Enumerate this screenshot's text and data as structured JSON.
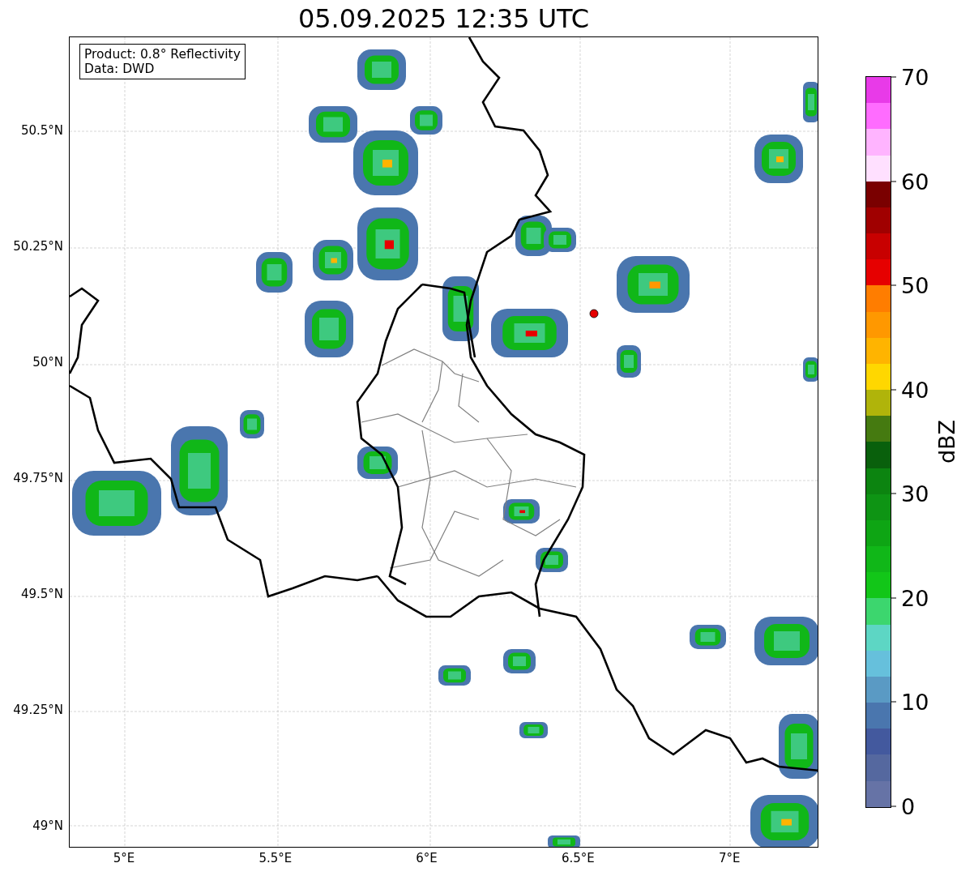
{
  "title": "05.09.2025 12:35 UTC",
  "info_box": [
    "Product: 0.8° Reflectivity",
    "Data: DWD"
  ],
  "x_ticks": [
    "5°E",
    "5.5°E",
    "6°E",
    "6.5°E",
    "7°E"
  ],
  "y_ticks": [
    "50.5°N",
    "50.25°N",
    "50°N",
    "49.75°N",
    "49.5°N",
    "49.25°N",
    "49°N"
  ],
  "colorbar": {
    "label": "dBZ",
    "ticks": [
      "70",
      "60",
      "50",
      "40",
      "30",
      "20",
      "10",
      "0"
    ],
    "bins": [
      {
        "color": "#e83ae8"
      },
      {
        "color": "#ff6cff"
      },
      {
        "color": "#ffb4ff"
      },
      {
        "color": "#ffe0ff"
      },
      {
        "color": "#7a0000"
      },
      {
        "color": "#a00000"
      },
      {
        "color": "#c80000"
      },
      {
        "color": "#e60000"
      },
      {
        "color": "#ff7d00"
      },
      {
        "color": "#ff9800"
      },
      {
        "color": "#ffb400"
      },
      {
        "color": "#ffd700"
      },
      {
        "color": "#b0b40a"
      },
      {
        "color": "#457a10"
      },
      {
        "color": "#09600c"
      },
      {
        "color": "#0c8410"
      },
      {
        "color": "#0e9414"
      },
      {
        "color": "#0ea514"
      },
      {
        "color": "#10b718"
      },
      {
        "color": "#12c618"
      },
      {
        "color": "#3cd66e"
      },
      {
        "color": "#5dd6c4"
      },
      {
        "color": "#66c0dc"
      },
      {
        "color": "#5a9ac4"
      },
      {
        "color": "#4a76ae"
      },
      {
        "color": "#43599e"
      },
      {
        "color": "#55689f"
      },
      {
        "color": "#6673a6"
      }
    ]
  }
}
